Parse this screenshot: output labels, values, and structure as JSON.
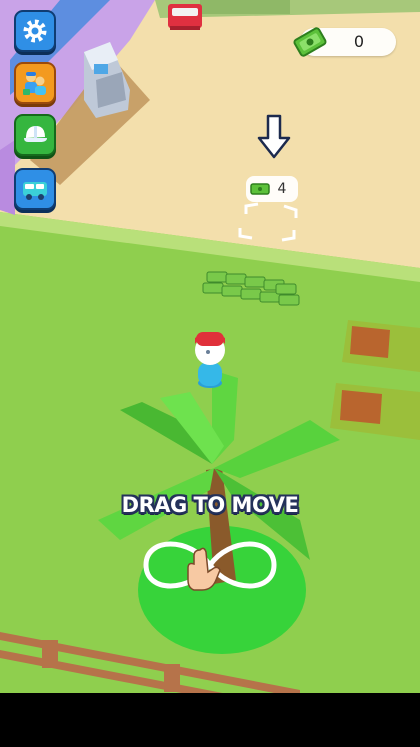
{
  "hud": {
    "cash_value": "0",
    "colors": {
      "button_blue": "#2f8fe6",
      "button_orange": "#f39a1f",
      "button_green": "#35b63f",
      "cash_pill": "#ffffff"
    }
  },
  "menu_buttons": [
    {
      "name": "settings-button",
      "icon": "gear-icon"
    },
    {
      "name": "hire-staff-button",
      "icon": "workers-icon"
    },
    {
      "name": "outfit-button",
      "icon": "cap-icon"
    },
    {
      "name": "vehicle-button",
      "icon": "van-icon"
    }
  ],
  "unlock_spot": {
    "cost": "4",
    "icon": "cash-icon"
  },
  "hint": {
    "text": "DRAG TO MOVE",
    "gesture": "infinity-swipe-icon"
  },
  "scene": {
    "colors": {
      "grass": "#8fcf4e",
      "floor": "#f3dfac",
      "wall": "#c9a3e8",
      "palm": "#58d23d",
      "shadow_circle": "#37d33a"
    }
  }
}
